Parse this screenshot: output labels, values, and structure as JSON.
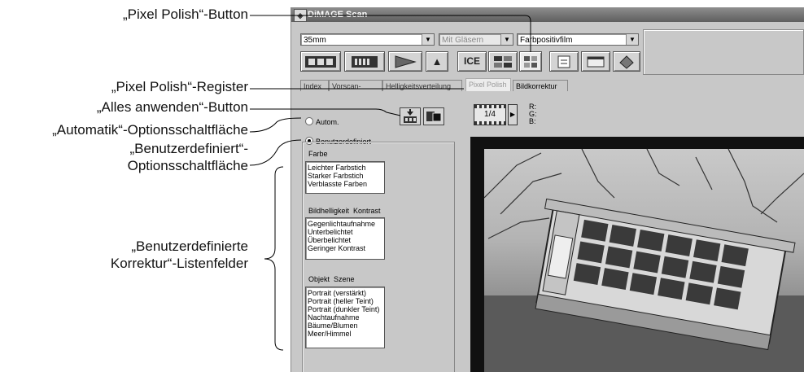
{
  "callouts": {
    "pixel_polish_button": "„Pixel Polish“-Button",
    "pixel_polish_tab": "„Pixel Polish“-Register",
    "apply_all_button": "„Alles anwenden“-Button",
    "auto_radio": "„Automatik“-Optionsschaltfläche",
    "custom_radio_line1": "„Benutzerdefiniert“-",
    "custom_radio_line2": "Optionsschaltfläche",
    "custom_lists_line1": "„Benutzerdefinierte",
    "custom_lists_line2": "Korrektur“-Listenfelder"
  },
  "window": {
    "title": "DiMAGE Scan"
  },
  "dropdowns": {
    "film_format": "35mm",
    "holder": "Mit Gläsern",
    "film_type": "Farbpositivfilm"
  },
  "toolbar": {
    "icons": [
      "film-strip-icon",
      "index-icon",
      "prescan-icon",
      "eject-icon",
      "ice-icon",
      "grain-dissolver-icon",
      "pixel-polish-icon",
      "settings-icon",
      "preferences-icon",
      "help-icon"
    ],
    "eject_glyph": "▲",
    "ice_glyph": "ICE"
  },
  "tabs": [
    "Index",
    "Vorscan-Ansicht",
    "Helligkeitsverteilung",
    "Pixel Polish",
    "Bildkorrektur"
  ],
  "panel": {
    "auto_label": "Autom.",
    "custom_label": "Benutzerdefiniert",
    "color_group": "Farbe",
    "color_items": [
      "Leichter Farbstich",
      "Starker Farbstich",
      "Verblasste Farben"
    ],
    "brightness_group": "Bildhelligkeit  Kontrast",
    "brightness_items": [
      "Gegenlichtaufnahme",
      "Unterbelichtet",
      "Überbelichtet",
      "Geringer Kontrast"
    ],
    "subject_group": "Objekt  Szene",
    "subject_items": [
      "Portrait (verstärkt)",
      "Portrait (heller Teint)",
      "Portrait (dunkler Teint)",
      "Nachtaufnahme",
      "Bäume/Blumen",
      "Meer/Himmel"
    ]
  },
  "frame": {
    "counter": "1/4",
    "r_label": "R:",
    "g_label": "G:",
    "b_label": "B:"
  }
}
